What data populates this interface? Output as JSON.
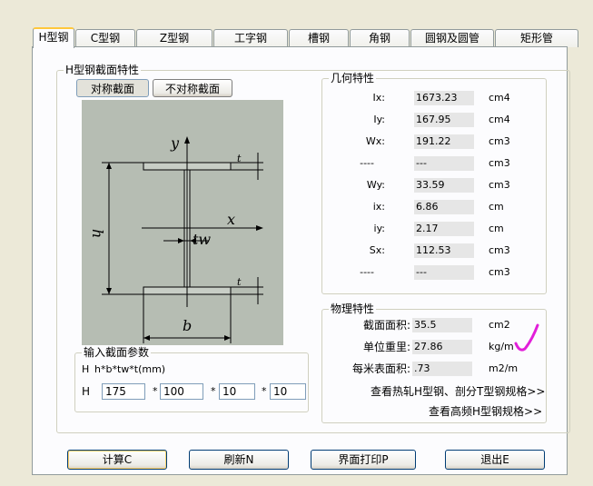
{
  "tabs": [
    {
      "label": "H型钢",
      "active": true
    },
    {
      "label": "C型钢"
    },
    {
      "label": "Z型钢"
    },
    {
      "label": "工字钢"
    },
    {
      "label": "槽钢"
    },
    {
      "label": "角钢"
    },
    {
      "label": "圆钢及圆管"
    },
    {
      "label": "矩形管"
    }
  ],
  "section": {
    "title": "H型钢截面特性",
    "symmetric_label": "对称截面",
    "asymmetric_label": "不对称截面"
  },
  "diagram": {
    "labels": {
      "y": "y",
      "x": "x",
      "h": "h",
      "b": "b",
      "tw": "tw",
      "t_top": "t",
      "t_bottom": "t"
    }
  },
  "geometry": {
    "title": "几何特性",
    "rows": [
      {
        "label": "Ix:",
        "value": "1673.23",
        "unit": "cm4"
      },
      {
        "label": "Iy:",
        "value": "167.95",
        "unit": "cm4"
      },
      {
        "label": "Wx:",
        "value": "191.22",
        "unit": "cm3"
      },
      {
        "label": "----",
        "value": "---",
        "unit": "cm3"
      },
      {
        "label": "Wy:",
        "value": "33.59",
        "unit": "cm3"
      },
      {
        "label": "ix:",
        "value": "6.86",
        "unit": "cm"
      },
      {
        "label": "iy:",
        "value": "2.17",
        "unit": "cm"
      },
      {
        "label": "Sx:",
        "value": "112.53",
        "unit": "cm3"
      },
      {
        "label": "----",
        "value": "---",
        "unit": "cm3"
      }
    ]
  },
  "physical": {
    "title": "物理特性",
    "rows": [
      {
        "label": "截面面积:",
        "value": "35.5",
        "unit": "cm2"
      },
      {
        "label": "单位重里:",
        "value": "27.86",
        "unit": "kg/m"
      },
      {
        "label": "每米表面积:",
        "value": ".73",
        "unit": "m2/m"
      }
    ],
    "link1": "查看热轧H型钢、剖分T型钢规格>>",
    "link2": "查看高频H型钢规格>>",
    "check_color": "#e21fd9"
  },
  "input": {
    "title": "输入截面参数",
    "formula_prefix": "H",
    "formula": "h*b*tw*t(mm)",
    "row_label": "H",
    "sep": "*",
    "h": "175",
    "b": "100",
    "tw": "10",
    "t": "10"
  },
  "buttons": {
    "calc": "计算C",
    "refresh": "刷新N",
    "print": "界面打印P",
    "exit": "退出E"
  }
}
